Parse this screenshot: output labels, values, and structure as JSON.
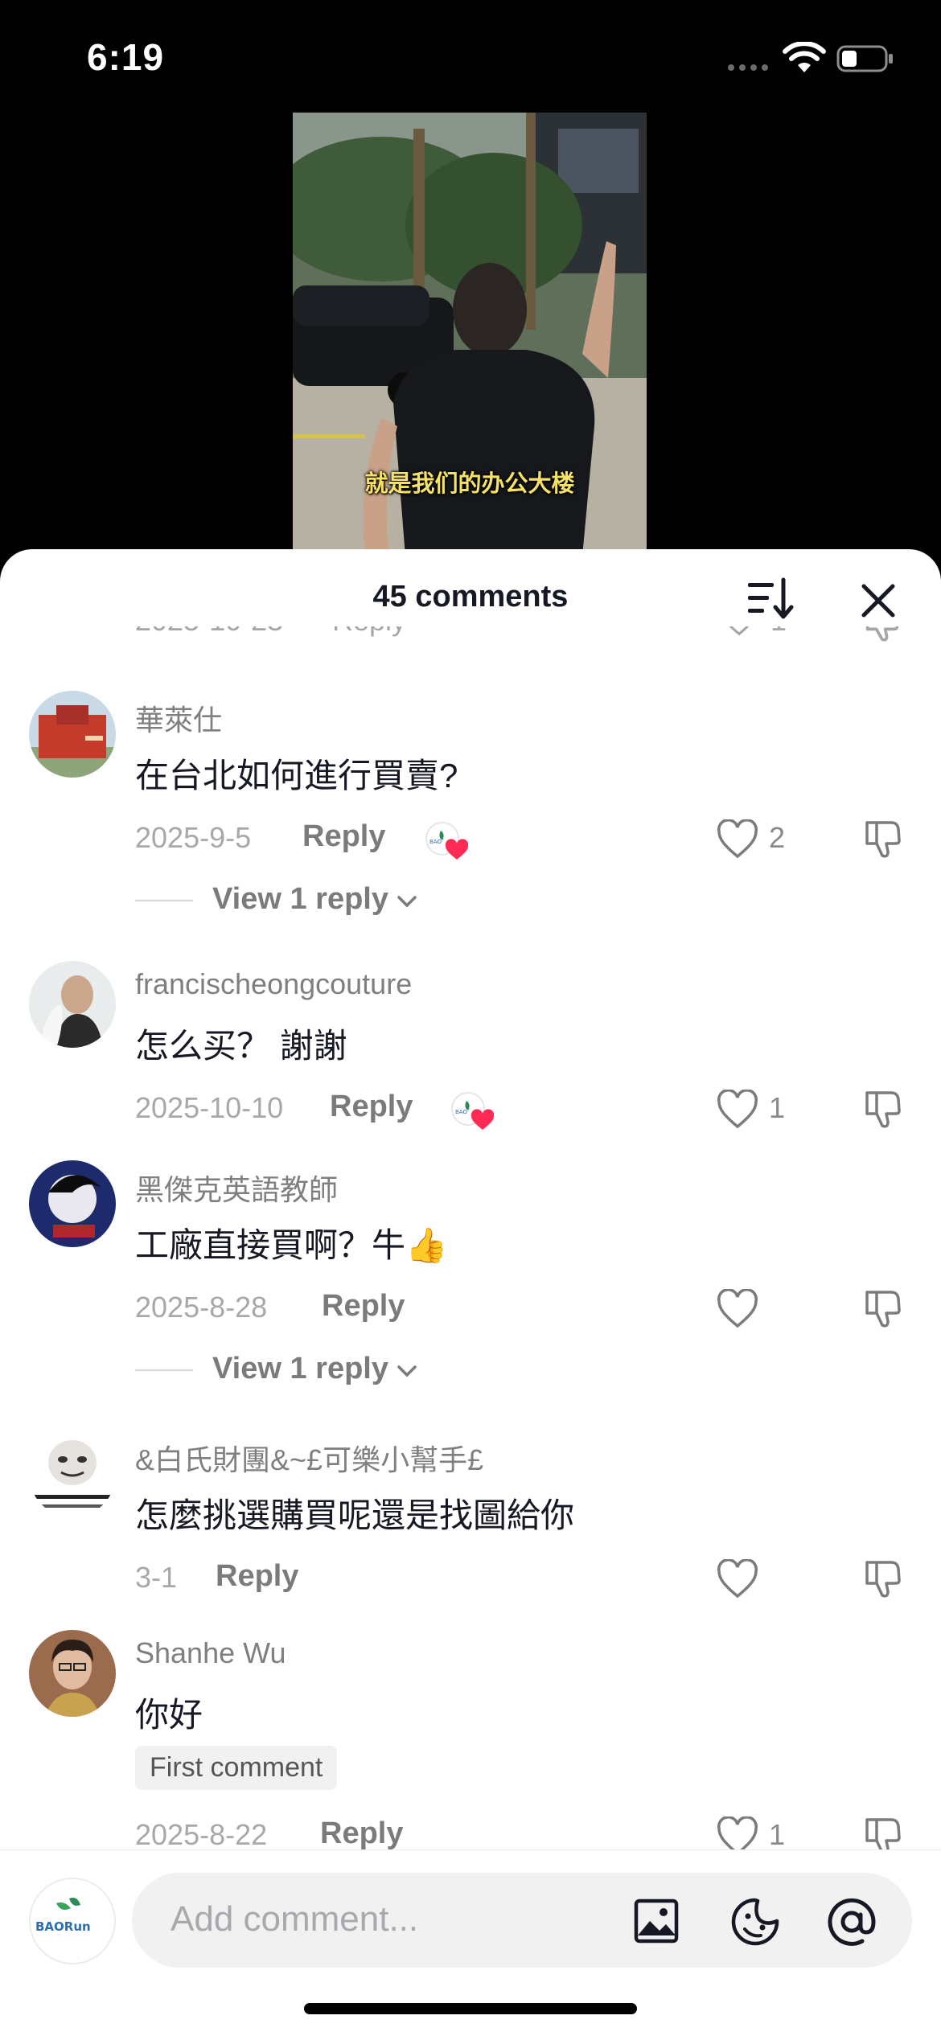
{
  "status_bar": {
    "time": "6:19"
  },
  "video": {
    "caption": "就是我们的办公大楼"
  },
  "sheet": {
    "title": "45 comments"
  },
  "previous_row": {
    "date": "2025-10-23",
    "reply": "Reply",
    "likes": "1"
  },
  "comments": [
    {
      "username": "華萊仕",
      "text": "在台北如何進行買賣?",
      "date": "2025-9-5",
      "reply_label": "Reply",
      "likes": "2",
      "view_replies": "View 1 reply"
    },
    {
      "username": "francischeongcouture",
      "text": "怎么买？ 謝謝",
      "date": "2025-10-10",
      "reply_label": "Reply",
      "likes": "1"
    },
    {
      "username": "黑傑克英語教師",
      "text": "工廠直接買啊？牛👍",
      "date": "2025-8-28",
      "reply_label": "Reply",
      "likes": "",
      "view_replies": "View 1 reply"
    },
    {
      "username": "&白氏財團&~£可樂小幫手£",
      "text": "怎麼挑選購買呢還是找圖給你",
      "date": "3-1",
      "reply_label": "Reply",
      "likes": ""
    },
    {
      "username": "Shanhe Wu",
      "text": "你好",
      "badge": "First comment",
      "date": "2025-8-22",
      "reply_label": "Reply",
      "likes": "1"
    }
  ],
  "composer": {
    "placeholder": "Add comment...",
    "avatar_brand": "BAORun"
  },
  "colors": {
    "heart_red": "#fe2c55",
    "text_primary": "#161823",
    "text_secondary": "#7f7f7f"
  }
}
